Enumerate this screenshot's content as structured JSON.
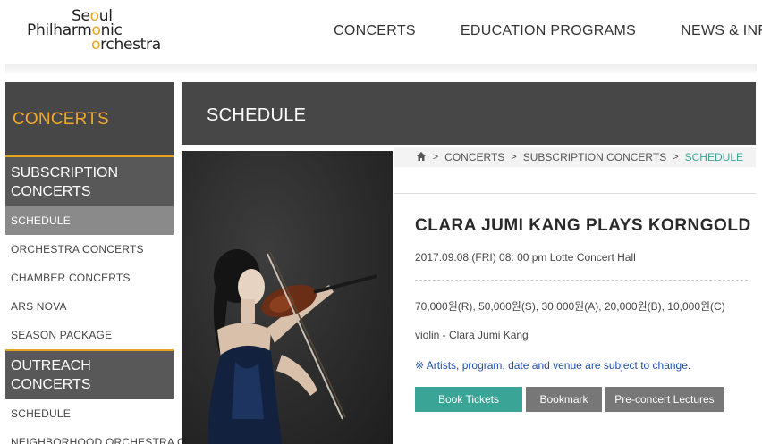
{
  "header": {
    "logo": {
      "line1_pre": "Se",
      "line1_o": "o",
      "line1_post": "ul",
      "line2_pre": "Philharm",
      "line2_o": "o",
      "line2_post": "nic",
      "line3_o": "o",
      "line3_post": "rchestra"
    },
    "nav": [
      "CONCERTS",
      "EDUCATION PROGRAMS",
      "NEWS & INFO"
    ]
  },
  "sidebar": {
    "title": "CONCERTS",
    "category1": "SUBSCRIPTION CONCERTS",
    "category1_items": [
      "SCHEDULE",
      "ORCHESTRA CONCERTS",
      "CHAMBER CONCERTS",
      "ARS NOVA",
      "SEASON PACKAGE"
    ],
    "category2": "OUTREACH CONCERTS",
    "category2_items": [
      "SCHEDULE",
      "NEIGHBORHOOD ORCHESTRA CONCERTS"
    ]
  },
  "banner": {
    "title": "SCHEDULE"
  },
  "breadcrumb": [
    "CONCERTS",
    "SUBSCRIPTION CONCERTS",
    "SCHEDULE"
  ],
  "concert": {
    "title": "CLARA JUMI KANG PLAYS KORNGOLD",
    "datetime_venue": "2017.09.08 (FRI) 08: 00 pm Lotte Concert Hall",
    "prices": "70,000원(R), 50,000원(S), 30,000원(A), 20,000원(B), 10,000원(C)",
    "performer": "violin - Clara Jumi Kang",
    "notice": "※ Artists, program, date and venue are subject to change.",
    "buttons": {
      "book": "Book Tickets",
      "bookmark": "Bookmark",
      "lectures": "Pre-concert Lectures"
    }
  },
  "colors": {
    "accent_orange": "#e8a31f",
    "teal": "#3aa597",
    "dark_panel": "#474747",
    "gray_button": "#777777",
    "notice_blue": "#1f4fa8"
  },
  "icons": {
    "breadcrumb_home": "home-icon",
    "breadcrumb_separator": "chevron-right-icon"
  }
}
